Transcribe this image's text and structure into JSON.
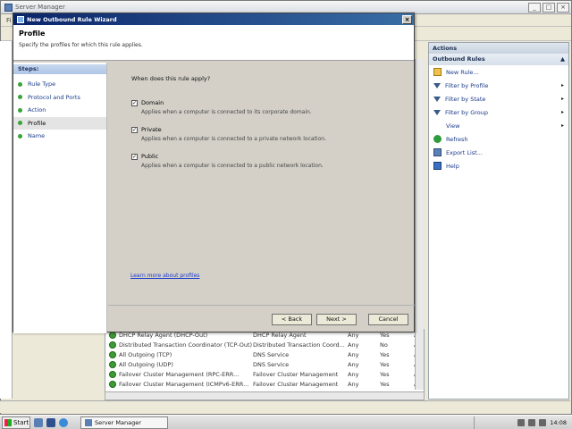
{
  "server_manager": {
    "title": "Server Manager",
    "menu_stub": "Fi"
  },
  "rules": {
    "rows": [
      {
        "name": "DHCP Relay Agent (DHCP-Out)",
        "group": "DHCP Relay Agent",
        "profile": "Any",
        "enabled": "Yes",
        "action": "A"
      },
      {
        "name": "Distributed Transaction Coordinator (TCP-Out)",
        "group": "Distributed Transaction Coord...",
        "profile": "Any",
        "enabled": "No",
        "action": "A"
      },
      {
        "name": "All Outgoing (TCP)",
        "group": "DNS Service",
        "profile": "Any",
        "enabled": "Yes",
        "action": "A"
      },
      {
        "name": "All Outgoing (UDP)",
        "group": "DNS Service",
        "profile": "Any",
        "enabled": "Yes",
        "action": "A"
      },
      {
        "name": "Failover Cluster Management (RPC-ERR...",
        "group": "Failover Cluster Management",
        "profile": "Any",
        "enabled": "Yes",
        "action": "A"
      },
      {
        "name": "Failover Cluster Management (ICMPv6-ERR...",
        "group": "Failover Cluster Management",
        "profile": "Any",
        "enabled": "Yes",
        "action": "A"
      }
    ]
  },
  "actions": {
    "header": "Actions",
    "section": "Outbound Rules",
    "collapse_glyph": "▲",
    "items": [
      {
        "label": "New Rule...",
        "icon": "new-rule-icon",
        "has_submenu": false
      },
      {
        "label": "Filter by Profile",
        "icon": "filter-icon",
        "has_submenu": true
      },
      {
        "label": "Filter by State",
        "icon": "filter-icon",
        "has_submenu": true
      },
      {
        "label": "Filter by Group",
        "icon": "filter-icon",
        "has_submenu": true
      },
      {
        "label": "View",
        "icon": "view-icon",
        "has_submenu": true
      },
      {
        "label": "Refresh",
        "icon": "refresh-icon",
        "has_submenu": false
      },
      {
        "label": "Export List...",
        "icon": "export-icon",
        "has_submenu": false
      },
      {
        "label": "Help",
        "icon": "help-icon",
        "has_submenu": false
      }
    ],
    "submenu_glyph": "▸"
  },
  "taskbar": {
    "start_label": "Start",
    "task_label": "Server Manager",
    "clock": "14:08"
  },
  "wizard": {
    "title": "New Outbound Rule Wizard",
    "close_glyph": "×",
    "page_title": "Profile",
    "page_subtitle": "Specify the profiles for which this rule applies.",
    "steps_header": "Steps:",
    "steps": [
      "Rule Type",
      "Protocol and Ports",
      "Action",
      "Profile",
      "Name"
    ],
    "current_step": 3,
    "question": "When does this rule apply?",
    "options": [
      {
        "label": "Domain",
        "description": "Applies when a computer is connected to its corporate domain.",
        "checked": true
      },
      {
        "label": "Private",
        "description": "Applies when a computer is connected to a private network location.",
        "checked": true
      },
      {
        "label": "Public",
        "description": "Applies when a computer is connected to a public network location.",
        "checked": true
      }
    ],
    "learn_more": "Learn more about profiles",
    "buttons": {
      "back": "< Back",
      "next": "Next >",
      "cancel": "Cancel"
    }
  },
  "colors": {
    "title_gradient_start": "#0a246a",
    "title_gradient_end": "#3a6ea5",
    "link": "#1a3acc",
    "step_dot": "#3aa33a"
  }
}
